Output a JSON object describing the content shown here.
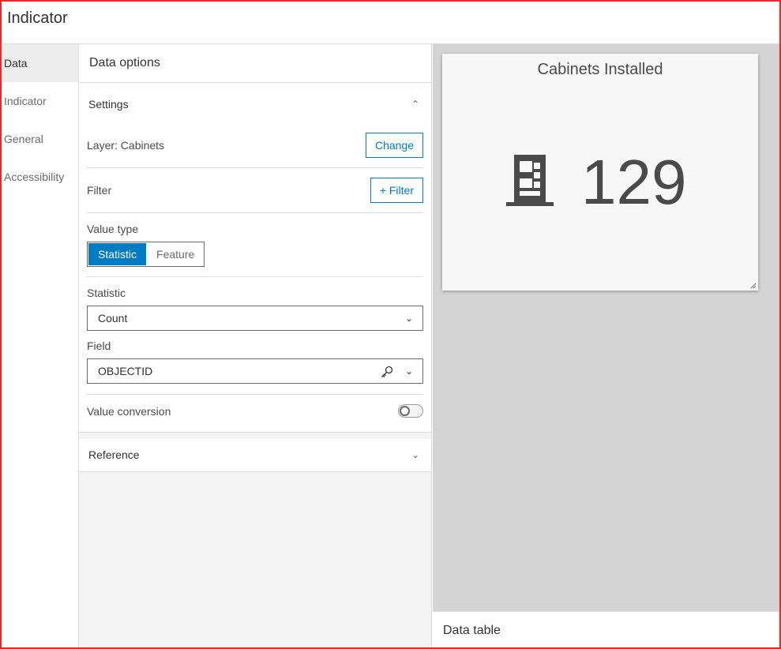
{
  "window": {
    "title": "Indicator"
  },
  "nav": {
    "items": [
      {
        "label": "Data"
      },
      {
        "label": "Indicator"
      },
      {
        "label": "General"
      },
      {
        "label": "Accessibility"
      }
    ]
  },
  "panel": {
    "header": "Data options",
    "settings": {
      "title": "Settings",
      "layer_label": "Layer: Cabinets",
      "change_label": "Change",
      "filter_label": "Filter",
      "filter_button": "+ Filter",
      "value_type_label": "Value type",
      "value_type_options": [
        "Statistic",
        "Feature"
      ],
      "value_type_selected": "Statistic",
      "statistic_label": "Statistic",
      "statistic_value": "Count",
      "field_label": "Field",
      "field_value": "OBJECTID",
      "value_conversion_label": "Value conversion",
      "value_conversion_on": false
    },
    "reference": {
      "title": "Reference"
    }
  },
  "preview": {
    "card_title": "Cabinets Installed",
    "value": "129",
    "icon": "cabinet-icon"
  },
  "data_table_label": "Data table",
  "colors": {
    "accent": "#007ac2",
    "frame": "#e52a2a",
    "preview_bg": "#d4d4d4"
  }
}
